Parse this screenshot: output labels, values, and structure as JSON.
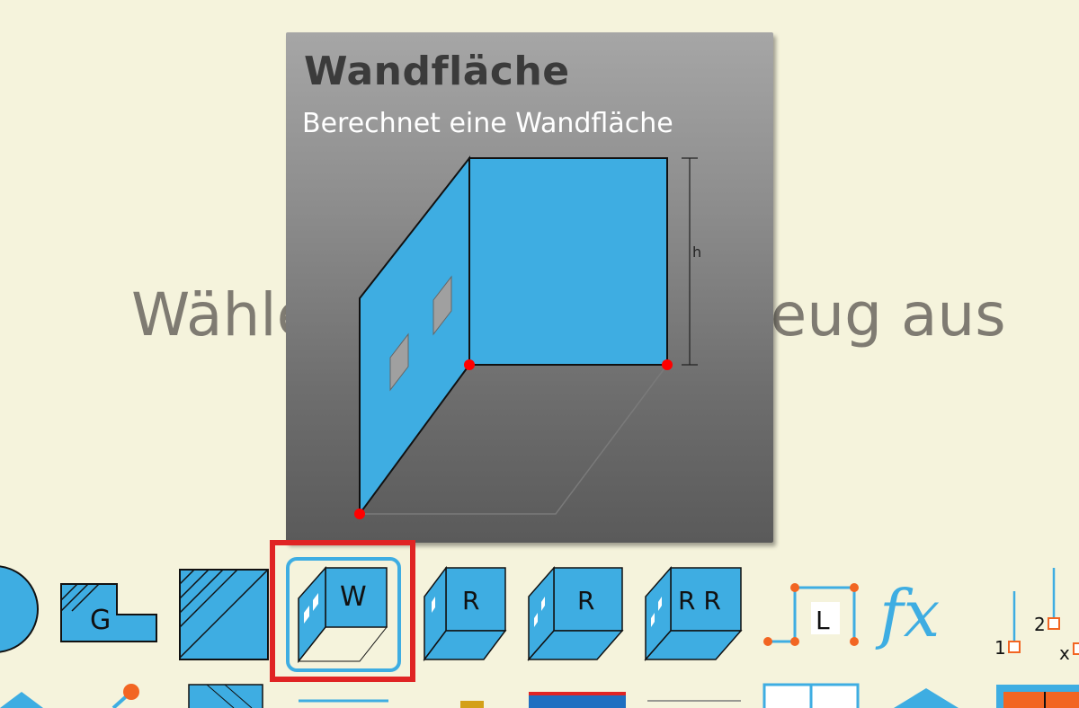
{
  "prompt": {
    "text": "Wählen Sie ein Werkzeug aus"
  },
  "tooltip": {
    "title": "Wandfläche",
    "subtitle": "Berechnet eine Wandfläche",
    "height_label": "h"
  },
  "toolbar": {
    "row1": [
      {
        "name": "circle-area-tool",
        "label": ""
      },
      {
        "name": "g-shape-tool",
        "label": "G"
      },
      {
        "name": "hatched-area-tool",
        "label": ""
      },
      {
        "name": "wall-area-tool",
        "label": "W",
        "selected": true
      },
      {
        "name": "room-tool",
        "label": "R"
      },
      {
        "name": "room-windows-tool",
        "label": "R"
      },
      {
        "name": "two-rooms-tool",
        "label": "R R"
      },
      {
        "name": "l-length-tool",
        "label": "L"
      },
      {
        "name": "formula-tool",
        "label": "fx"
      },
      {
        "name": "numbered-points-tool",
        "label_1": "1",
        "label_2": "2",
        "label_x": "x"
      }
    ]
  },
  "colors": {
    "background": "#f5f3dc",
    "accent_blue": "#3eade2",
    "marker_red": "#ff0000",
    "highlight_red": "#e02424",
    "orange": "#f26522"
  }
}
